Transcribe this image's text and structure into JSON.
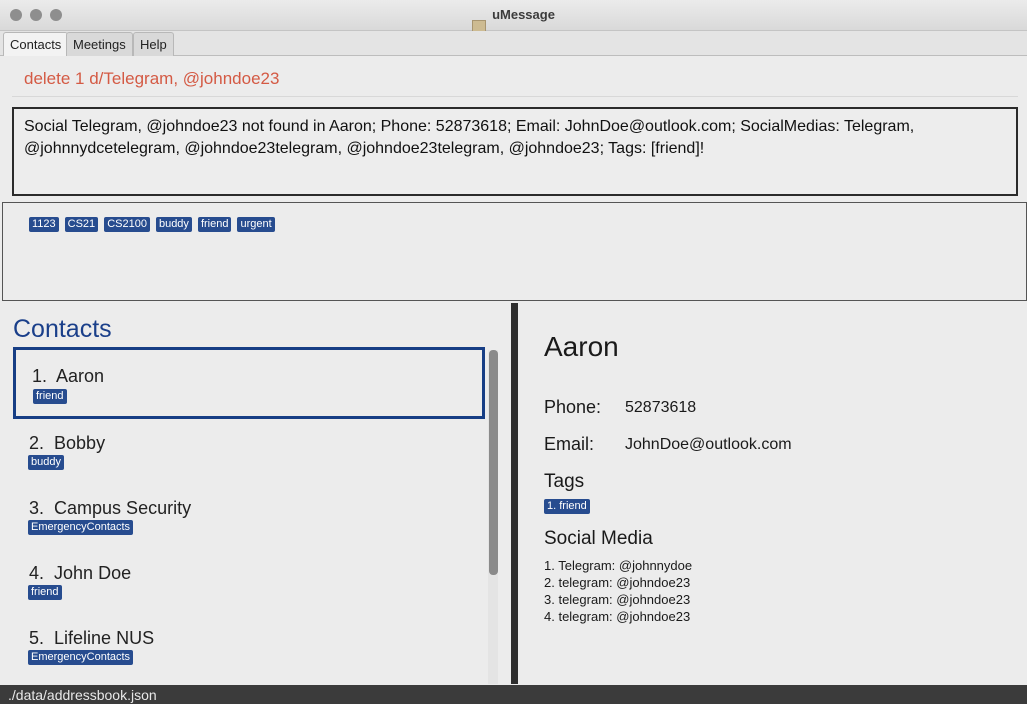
{
  "window": {
    "title": "uMessage"
  },
  "tabs": [
    "Contacts",
    "Meetings",
    "Help"
  ],
  "command": {
    "text": "delete 1 d/Telegram, @johndoe23"
  },
  "result": {
    "line1": "Social Telegram, @johndoe23 not found in Aaron; Phone: 52873618; Email: JohnDoe@outlook.com; SocialMedias: Telegram,",
    "line2": "@johnnydcetelegram, @johndoe23telegram, @johndoe23telegram, @johndoe23; Tags: [friend]!"
  },
  "tag_list": [
    "1123",
    "CS21",
    "CS2100",
    "buddy",
    "friend",
    "urgent"
  ],
  "contacts": {
    "title": "Contacts",
    "items": [
      {
        "index": "1.",
        "name": "Aaron",
        "tag": "friend"
      },
      {
        "index": "2.",
        "name": "Bobby",
        "tag": "buddy"
      },
      {
        "index": "3.",
        "name": "Campus Security",
        "tag": "EmergencyContacts"
      },
      {
        "index": "4.",
        "name": "John Doe",
        "tag": "friend"
      },
      {
        "index": "5.",
        "name": "Lifeline NUS",
        "tag": "EmergencyContacts"
      }
    ]
  },
  "detail": {
    "name": "Aaron",
    "phone_label": "Phone:",
    "phone": "52873618",
    "email_label": "Email:",
    "email": "JohnDoe@outlook.com",
    "tags_label": "Tags",
    "tags": [
      "1. friend"
    ],
    "social_label": "Social Media",
    "social": [
      "1. Telegram: @johnnydoe",
      "2. telegram: @johndoe23",
      "3. telegram: @johndoe23",
      "4. telegram: @johndoe23"
    ]
  },
  "status": {
    "path": "./data/addressbook.json"
  }
}
